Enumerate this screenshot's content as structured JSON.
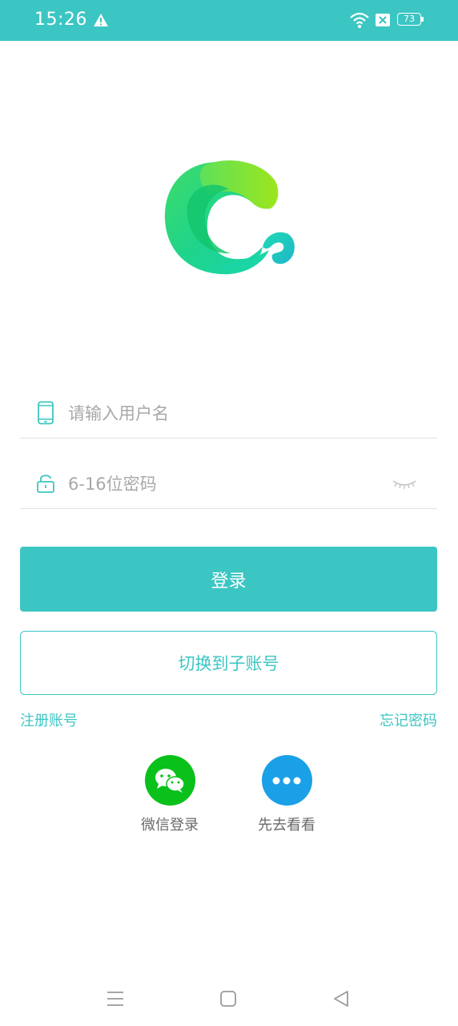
{
  "status_bar": {
    "time": "15:26",
    "battery": "73",
    "icons": [
      "warning-icon",
      "wifi-icon",
      "sim-disabled-icon",
      "battery-icon"
    ]
  },
  "login_form": {
    "username": {
      "placeholder": "请输入用户名",
      "value": ""
    },
    "password": {
      "placeholder": "6-16位密码",
      "value": ""
    }
  },
  "actions": {
    "login": "登录",
    "switch_account": "切换到子账号",
    "register": "注册账号",
    "forgot_password": "忘记密码"
  },
  "social": {
    "wechat": "微信登录",
    "browse": "先去看看"
  },
  "colors": {
    "accent": "#3cc6c3",
    "wechat": "#09c11a",
    "browse": "#1aa0e6",
    "placeholder": "#a8a8a8"
  }
}
